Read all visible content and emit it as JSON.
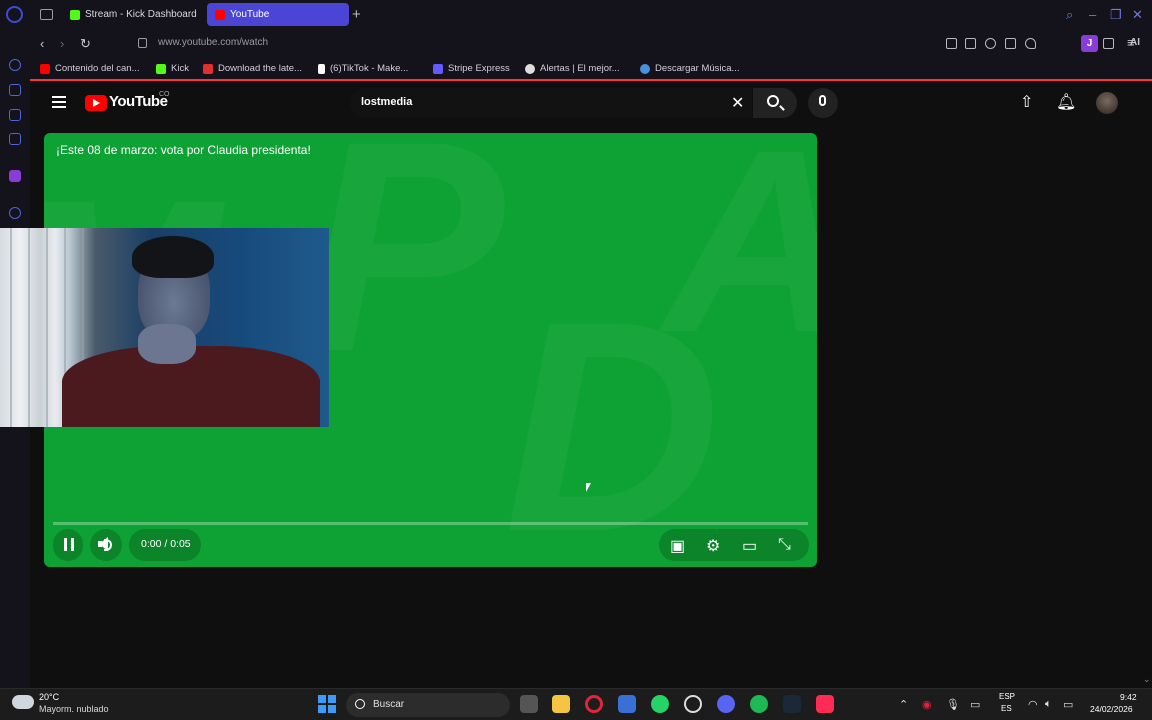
{
  "browser": {
    "tabs": [
      {
        "label": "Stream - Kick Dashboard",
        "favicon_color": "#53fc18"
      },
      {
        "label": "YouTube",
        "favicon_color": "#ff0000",
        "active": true
      }
    ],
    "new_tab_symbol": "+",
    "url": "www.youtube.com/watch",
    "extension_badge": "J",
    "extension_ai": "AI"
  },
  "bookmarks": [
    {
      "label": "Contenido del can...",
      "favicon_color": "#ff0000"
    },
    {
      "label": "Kick",
      "favicon_color": "#53fc18"
    },
    {
      "label": "Download the late...",
      "favicon_color": "#e03030"
    },
    {
      "label": "(6)TikTok - Make...",
      "favicon_color": "#ffffff"
    },
    {
      "label": "Stripe Express",
      "favicon_color": "#635bff"
    },
    {
      "label": "Alertas | El mejor...",
      "favicon_color": "#dddddd"
    },
    {
      "label": "Descargar Música...",
      "favicon_color": "#4a90e2"
    }
  ],
  "youtube": {
    "logo_text": "YouTube",
    "logo_region": "CO",
    "search_value": "lostmedia"
  },
  "player": {
    "title": "¡Este 08 de marzo: vota por Claudia presidenta!",
    "time": "0:00 / 0:05",
    "progress": 0.0,
    "background_color": "#0ea234"
  },
  "taskbar": {
    "temperature": "20°C",
    "condition": "Mayorm. nublado",
    "search_label": "Buscar",
    "lang_top": "ESP",
    "lang_bottom": "ES",
    "time": "9:42",
    "date": "24/02/2026"
  }
}
